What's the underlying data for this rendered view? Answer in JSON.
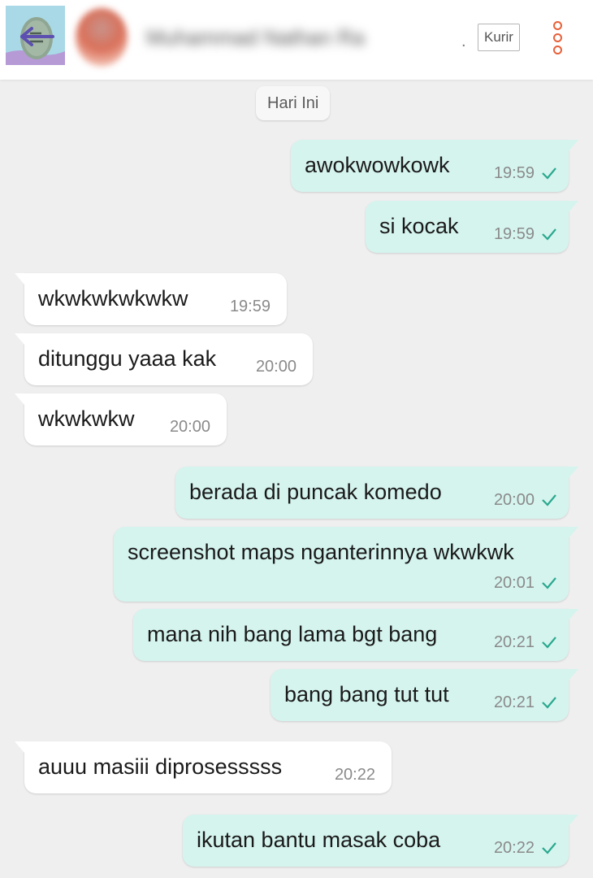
{
  "header": {
    "back_icon": "arrow-left-icon",
    "contact_name": "Muhammad Nathan Ra",
    "ellipsis": ".",
    "role_badge": "Kurir",
    "menu_icon": "vertical-dots-icon",
    "accent_color": "#e86038"
  },
  "chat": {
    "date_label": "Hari Ini",
    "outgoing_color": "#d5f4ee",
    "incoming_color": "#ffffff",
    "check_color": "#2aa88f",
    "messages": [
      {
        "text": "awokwowkowk",
        "time": "19:59",
        "direction": "out",
        "status": "sent"
      },
      {
        "text": "si kocak",
        "time": "19:59",
        "direction": "out",
        "status": "sent"
      },
      {
        "text": "wkwkwkwkwkw",
        "time": "19:59",
        "direction": "in"
      },
      {
        "text": "ditunggu yaaa kak",
        "time": "20:00",
        "direction": "in"
      },
      {
        "text": "wkwkwkw",
        "time": "20:00",
        "direction": "in"
      },
      {
        "text": "berada di puncak komedo",
        "time": "20:00",
        "direction": "out",
        "status": "sent"
      },
      {
        "text": "screenshot maps nganterinnya wkwkwk",
        "time": "20:01",
        "direction": "out",
        "status": "sent"
      },
      {
        "text": "mana nih bang lama bgt bang",
        "time": "20:21",
        "direction": "out",
        "status": "sent"
      },
      {
        "text": "bang bang tut tut",
        "time": "20:21",
        "direction": "out",
        "status": "sent"
      },
      {
        "text": "auuu masiii diprosesssss",
        "time": "20:22",
        "direction": "in"
      },
      {
        "text": "ikutan bantu masak coba",
        "time": "20:22",
        "direction": "out",
        "status": "sent"
      }
    ]
  }
}
